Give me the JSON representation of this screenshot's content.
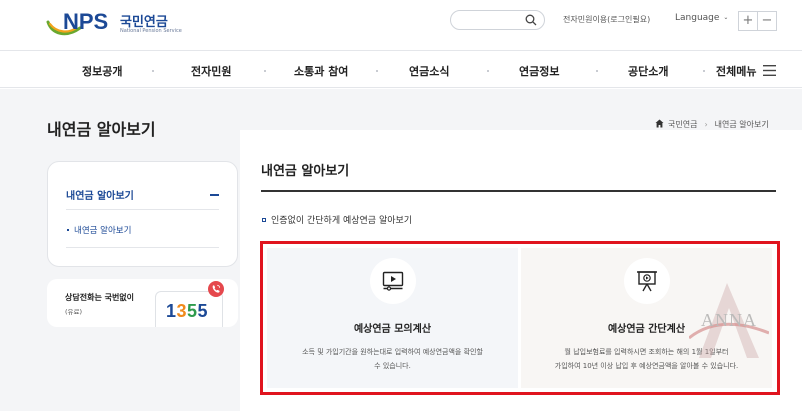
{
  "header": {
    "logo": {
      "mark": "NPS",
      "name_ko": "국민연금",
      "name_en": "National Pension Service"
    },
    "search": {
      "placeholder": ""
    },
    "login_link": "전자민원이용(로그인필요)",
    "language": "Language",
    "zoom_in": "+",
    "zoom_out": "−"
  },
  "nav": {
    "items": [
      "정보공개",
      "전자민원",
      "소통과 참여",
      "연금소식",
      "연금정보",
      "공단소개",
      "전체메뉴"
    ]
  },
  "page": {
    "title": "내연금 알아보기",
    "breadcrumb": [
      "국민연금",
      "내연금 알아보기"
    ]
  },
  "sidebar": {
    "head": "내연금 알아보기",
    "sub": "내연금 알아보기",
    "call_title": "상담전화는 국번없이",
    "call_note": "(유료)",
    "phone": [
      "1",
      "3",
      "5",
      "5"
    ]
  },
  "content": {
    "title": "내연금 알아보기",
    "intro": "인증없이 간단하게 예상연금 알아보기",
    "cards": [
      {
        "title": "예상연금 모의계산",
        "desc1": "소득 및 가입기간을 원하는대로 입력하여 예상연금액을 확인할",
        "desc2": "수 있습니다.",
        "icon": "monitor-play-icon"
      },
      {
        "title": "예상연금 간단계산",
        "desc1": "월 납입보험료를 입력하시면 조회하는 해의 1월 1일부터",
        "desc2": "가입하여 10년 이상 납입 후 예상연금액을 알아볼 수 있습니다.",
        "icon": "presentation-icon"
      }
    ]
  },
  "watermark": {
    "text": "ANNA"
  },
  "colors": {
    "brand_blue": "#1c4996",
    "highlight_red": "#e0141e",
    "phone_red": "#e5484d",
    "phone_green": "#2e9b4d",
    "phone_orange": "#f08a1c"
  }
}
